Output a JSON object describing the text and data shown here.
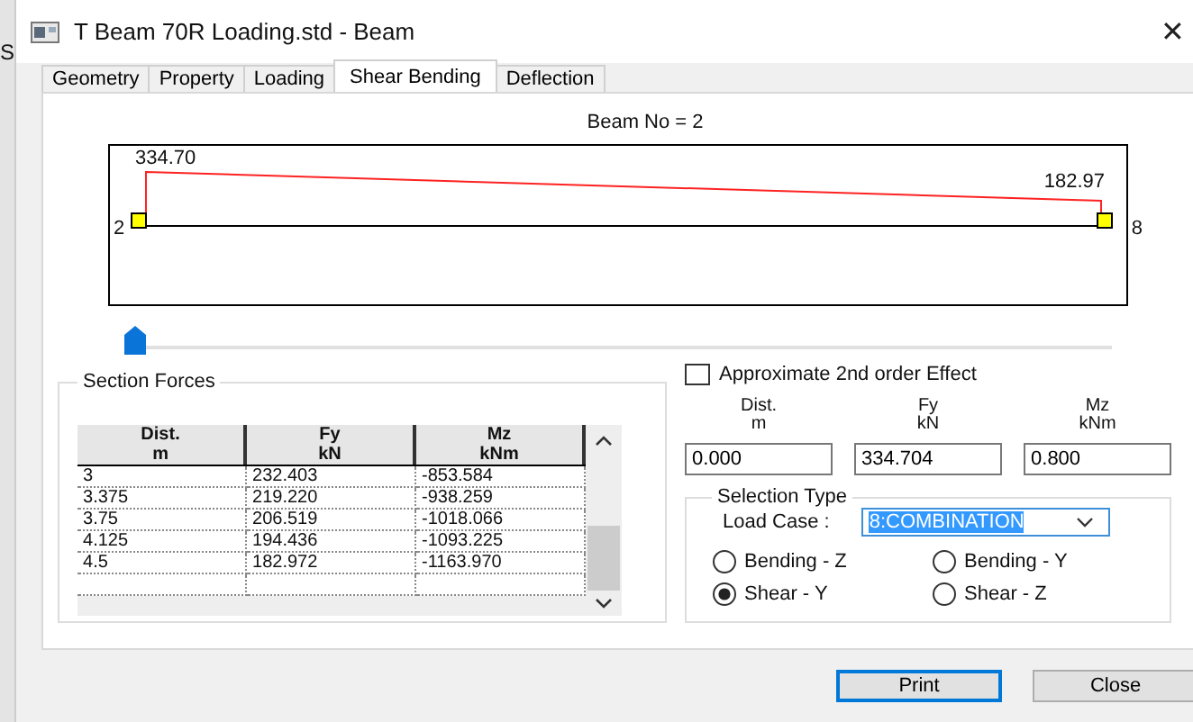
{
  "background_app": {
    "fragment": "S"
  },
  "window": {
    "title": "T Beam 70R Loading.std - Beam",
    "close": "✕"
  },
  "tabs": [
    {
      "label": "Geometry",
      "selected": false
    },
    {
      "label": "Property",
      "selected": false
    },
    {
      "label": "Loading",
      "selected": false
    },
    {
      "label": "Shear Bending",
      "selected": true
    },
    {
      "label": "Deflection",
      "selected": false
    }
  ],
  "diagram": {
    "title": "Beam No = 2",
    "start_value": "334.70",
    "end_value": "182.97",
    "start_node": "2",
    "end_node": "8"
  },
  "slider": {
    "level": 0
  },
  "section_forces": {
    "title": "Section Forces",
    "columns": [
      {
        "name": "Dist.",
        "unit": "m"
      },
      {
        "name": "Fy",
        "unit": "kN"
      },
      {
        "name": "Mz",
        "unit": "kNm"
      }
    ],
    "rows": [
      [
        "3",
        "232.403",
        "-853.584"
      ],
      [
        "3.375",
        "219.220",
        "-938.259"
      ],
      [
        "3.75",
        "206.519",
        "-1018.066"
      ],
      [
        "4.125",
        "194.436",
        "-1093.225"
      ],
      [
        "4.5",
        "182.972",
        "-1163.970"
      ]
    ]
  },
  "second_order": {
    "label": "Approximate 2nd order Effect",
    "checked": false
  },
  "values": [
    {
      "name": "Dist.",
      "unit": "m",
      "value": "0.000"
    },
    {
      "name": "Fy",
      "unit": "kN",
      "value": "334.704"
    },
    {
      "name": "Mz",
      "unit": "kNm",
      "value": "0.800"
    }
  ],
  "selection_type": {
    "title": "Selection Type",
    "load_case_label": "Load Case :",
    "load_case": "8:COMBINATION",
    "options": [
      {
        "label": "Bending - Z",
        "selected": false
      },
      {
        "label": "Bending - Y",
        "selected": false
      },
      {
        "label": "Shear - Y",
        "selected": true
      },
      {
        "label": "Shear - Z",
        "selected": false
      }
    ]
  },
  "buttons": [
    {
      "label": "Print",
      "default": true
    },
    {
      "label": "Close",
      "default": false
    }
  ]
}
